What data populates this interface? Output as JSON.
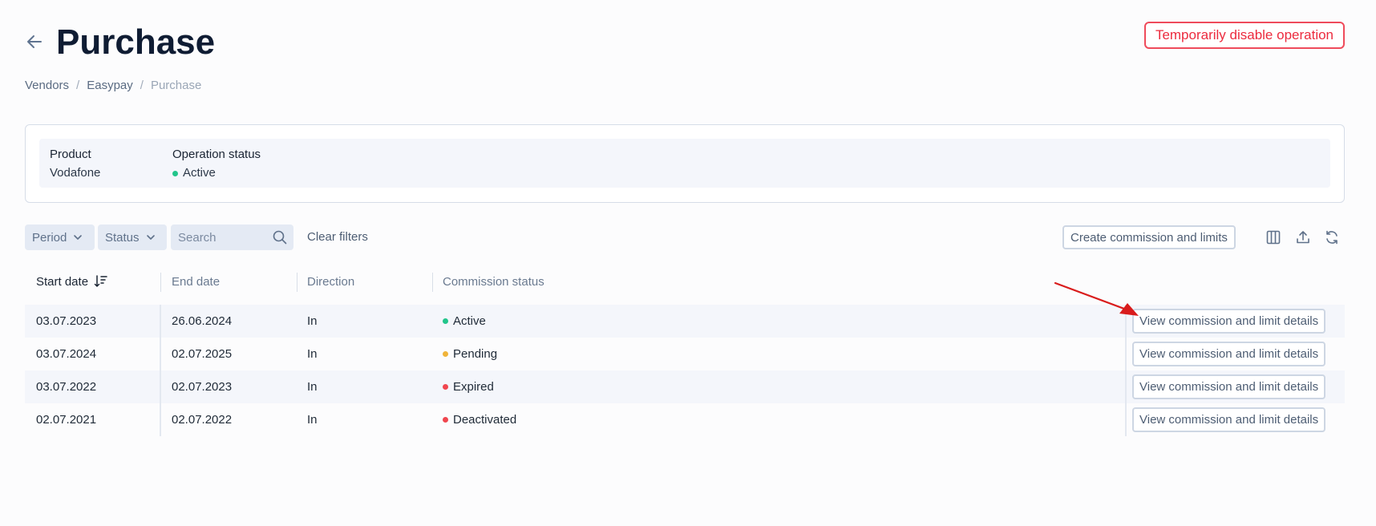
{
  "header": {
    "title": "Purchase",
    "disable_label": "Temporarily disable operation"
  },
  "breadcrumb": {
    "items": [
      "Vendors",
      "Easypay",
      "Purchase"
    ],
    "separator": "/"
  },
  "info": {
    "product_label": "Product",
    "product_value": "Vodafone",
    "status_label": "Operation status",
    "status_value": "Active",
    "status_color": "#22c58b"
  },
  "filters": {
    "period_label": "Period",
    "status_label": "Status",
    "search_placeholder": "Search",
    "clear_label": "Clear filters",
    "create_label": "Create commission and limits"
  },
  "table": {
    "columns": [
      "Start date",
      "End date",
      "Direction",
      "Commission status"
    ],
    "rows": [
      {
        "start": "03.07.2023",
        "end": "26.06.2024",
        "direction": "In",
        "status": "Active",
        "status_color": "#22c58b",
        "action": "View commission and limit details"
      },
      {
        "start": "03.07.2024",
        "end": "02.07.2025",
        "direction": "In",
        "status": "Pending",
        "status_color": "#f0b43a",
        "action": "View commission and limit details"
      },
      {
        "start": "03.07.2022",
        "end": "02.07.2023",
        "direction": "In",
        "status": "Expired",
        "status_color": "#f0464f",
        "action": "View commission and limit details"
      },
      {
        "start": "02.07.2021",
        "end": "02.07.2022",
        "direction": "In",
        "status": "Deactivated",
        "status_color": "#f0464f",
        "action": "View commission and limit details"
      }
    ]
  },
  "colors": {
    "accent_red": "#ec2b3e",
    "annotation_arrow": "#d91c1c"
  },
  "icons": {
    "back": "arrow-left-icon",
    "sort": "sort-descending-icon",
    "search": "search-icon",
    "columns": "columns-icon",
    "export": "upload-icon",
    "refresh": "refresh-icon"
  }
}
